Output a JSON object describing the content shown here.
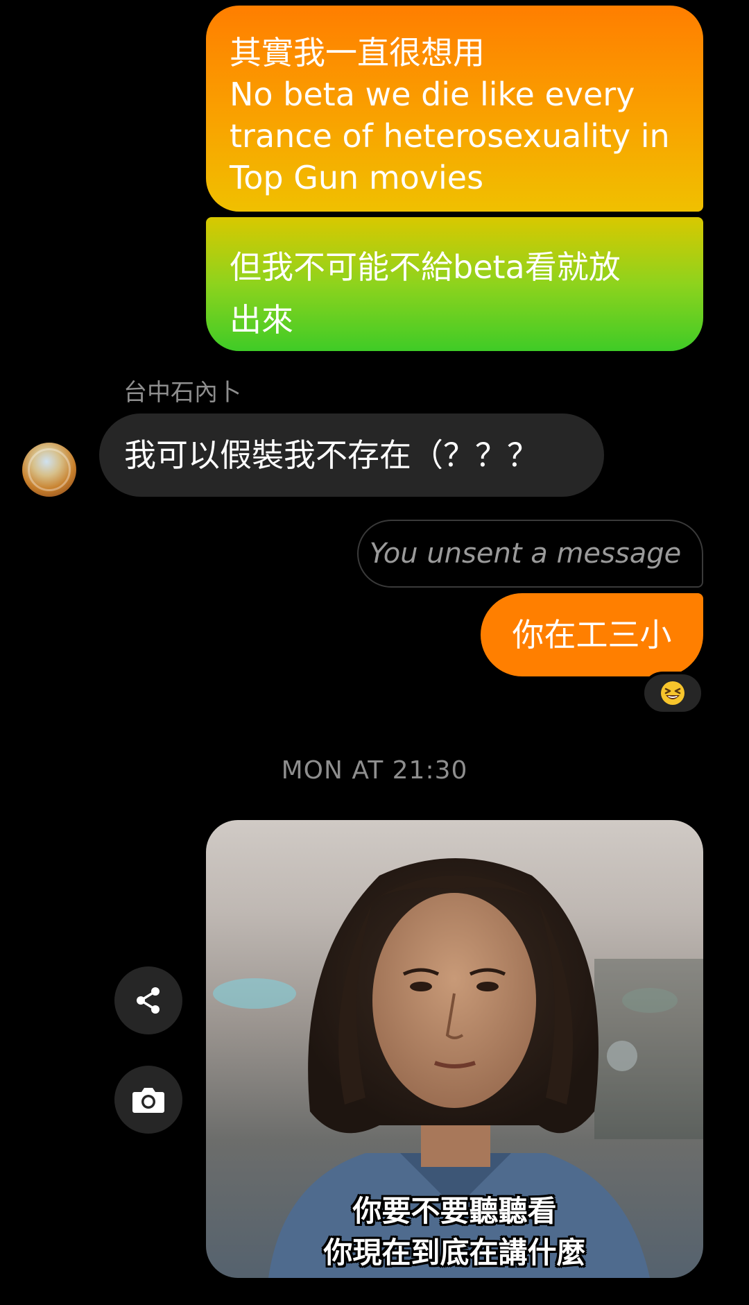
{
  "messages": {
    "out_1": {
      "lines": [
        "其實我一直很想用",
        "No beta we die like every",
        "trance of heterosexuality in",
        "Top Gun movies"
      ]
    },
    "out_2": {
      "lines": [
        "但我不可能不給beta看就放",
        "出來"
      ]
    },
    "incoming_sender": "台中石內卜",
    "incoming_1": "我可以假裝我不存在（？？？",
    "unsent": "You unsent a message",
    "out_3": "你在工三小",
    "reaction_emoji": "😆"
  },
  "timestamp": "MON AT 21:30",
  "image_message": {
    "subtitle_lines": [
      "你要不要聽聽看",
      "你現在到底在講什麼"
    ]
  },
  "icons": {
    "share": "share-icon",
    "camera": "camera-icon",
    "avatar": "avatar"
  },
  "colors": {
    "background": "#000000",
    "incoming_bubble": "#262626",
    "outgoing_orange": "#ff7f00",
    "outgoing_green": "#3fcb27",
    "muted_text": "#8e8e8e"
  }
}
